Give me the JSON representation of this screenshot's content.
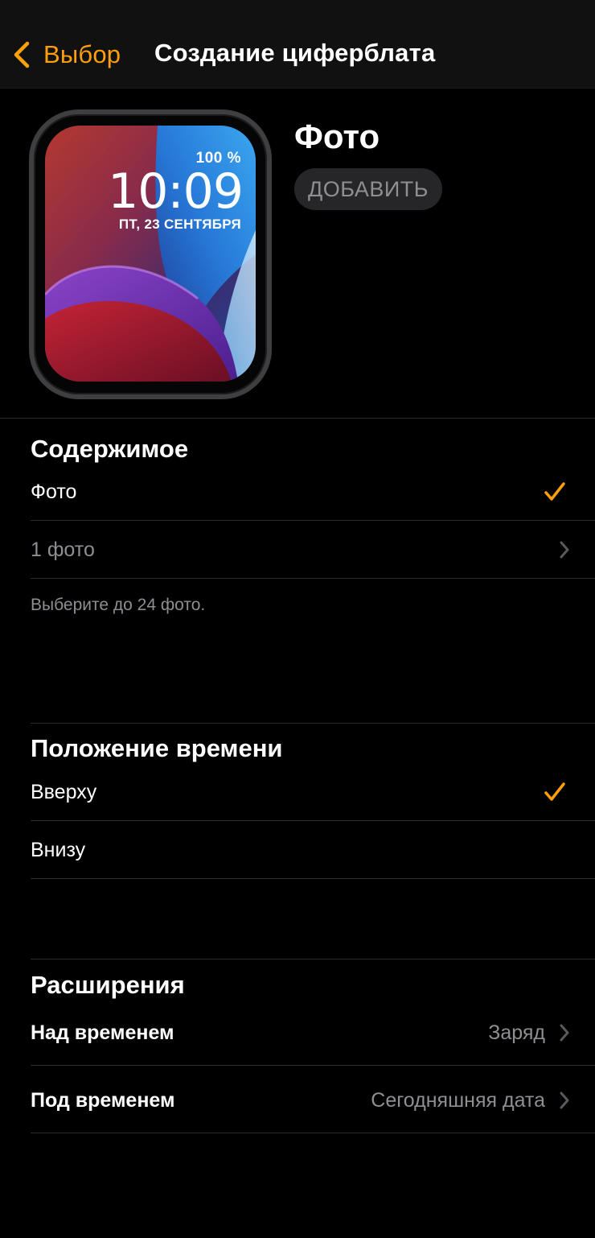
{
  "nav": {
    "back_label": "Выбор",
    "title": "Создание циферблата"
  },
  "watch": {
    "battery": "100 %",
    "time": "10:09",
    "date": "ПТ, 23 СЕНТЯБРЯ"
  },
  "face": {
    "title": "Фото",
    "add_label": "ДОБАВИТЬ"
  },
  "content_section": {
    "header": "Содержимое",
    "items": [
      {
        "label": "Фото",
        "checked": true
      },
      {
        "label": "1 фото"
      }
    ],
    "note": "Выберите до 24 фото."
  },
  "time_position_section": {
    "header": "Положение времени",
    "items": [
      {
        "label": "Вверху",
        "checked": true
      },
      {
        "label": "Внизу",
        "checked": false
      }
    ]
  },
  "complications_section": {
    "header": "Расширения",
    "items": [
      {
        "label": "Над временем",
        "value": "Заряд"
      },
      {
        "label": "Под временем",
        "value": "Сегодняшняя дата"
      }
    ]
  },
  "colors": {
    "accent": "#ff9f0a",
    "background": "#000000",
    "secondary_text": "#8e8e93"
  },
  "icons": [
    "chevron-left-icon",
    "checkmark-icon",
    "chevron-right-icon"
  ]
}
